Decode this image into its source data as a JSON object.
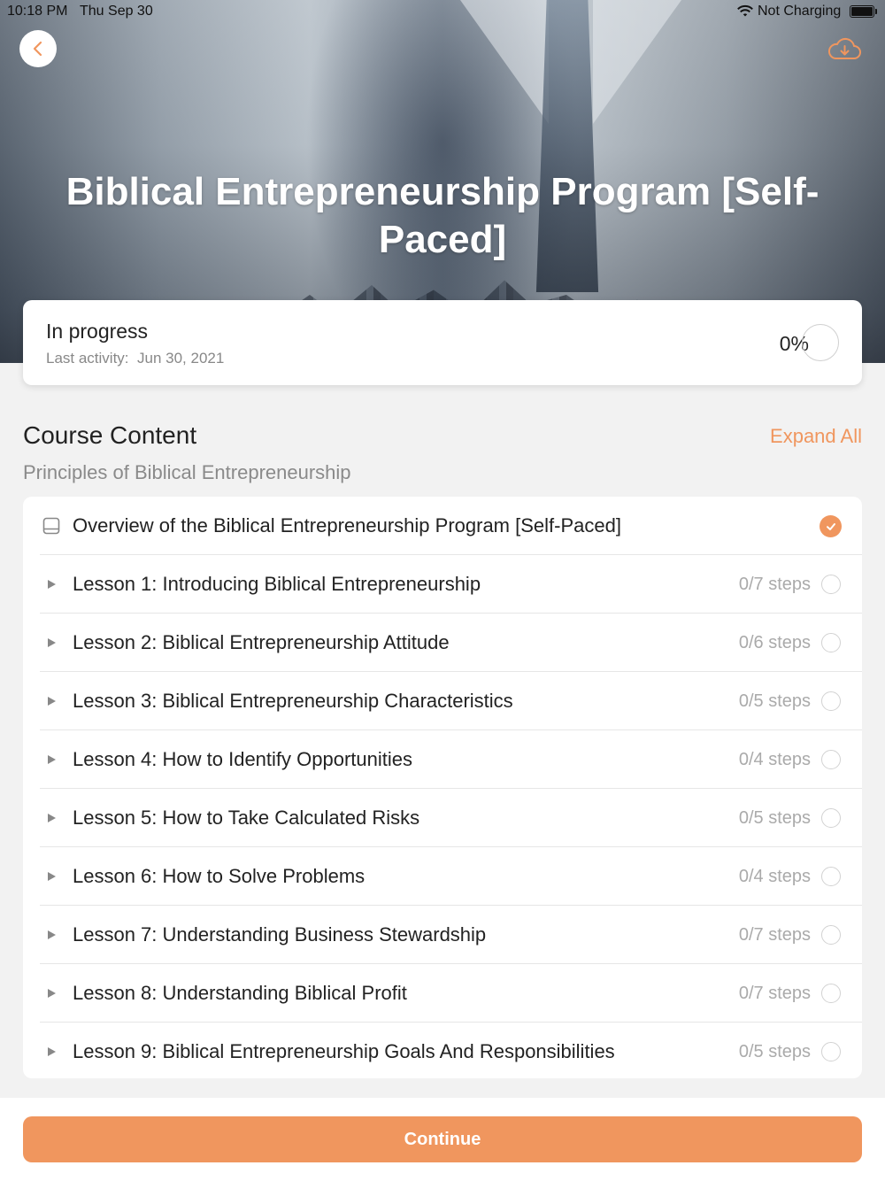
{
  "status_bar": {
    "time": "10:18 PM",
    "date": "Thu Sep 30",
    "charging": "Not Charging"
  },
  "course": {
    "title": "Biblical Entrepreneurship Program [Self-Paced]"
  },
  "progress": {
    "status": "In progress",
    "last_activity_label": "Last activity:",
    "last_activity_date": "Jun 30, 2021",
    "percent_text": "0%",
    "percent_value": 0
  },
  "content": {
    "section_title": "Course Content",
    "expand_all": "Expand All",
    "module_title": "Principles of Biblical Entrepreneurship",
    "overview": {
      "label": "Overview of the Biblical Entrepreneurship Program [Self-Paced]",
      "icon": "book-icon",
      "completed": true
    },
    "lessons": [
      {
        "label": "Lesson 1: Introducing Biblical Entrepreneurship",
        "steps": "0/7 steps"
      },
      {
        "label": "Lesson 2: Biblical Entrepreneurship Attitude",
        "steps": "0/6 steps"
      },
      {
        "label": "Lesson 3: Biblical Entrepreneurship Characteristics",
        "steps": "0/5 steps"
      },
      {
        "label": "Lesson 4: How to Identify Opportunities",
        "steps": "0/4 steps"
      },
      {
        "label": "Lesson 5: How to Take Calculated Risks",
        "steps": "0/5 steps"
      },
      {
        "label": "Lesson 6: How to Solve Problems",
        "steps": "0/4 steps"
      },
      {
        "label": "Lesson 7: Understanding Business Stewardship",
        "steps": "0/7 steps"
      },
      {
        "label": "Lesson 8: Understanding Biblical Profit",
        "steps": "0/7 steps"
      },
      {
        "label": "Lesson 9: Biblical Entrepreneurship Goals And Responsibilities",
        "steps": "0/5 steps"
      }
    ]
  },
  "actions": {
    "continue": "Continue"
  },
  "colors": {
    "accent": "#f0965e",
    "background": "#f2f2f2"
  },
  "icons": {
    "back": "chevron-left-icon",
    "download": "cloud-download-icon",
    "lesson_expand": "triangle-right-icon",
    "check": "check-icon"
  }
}
